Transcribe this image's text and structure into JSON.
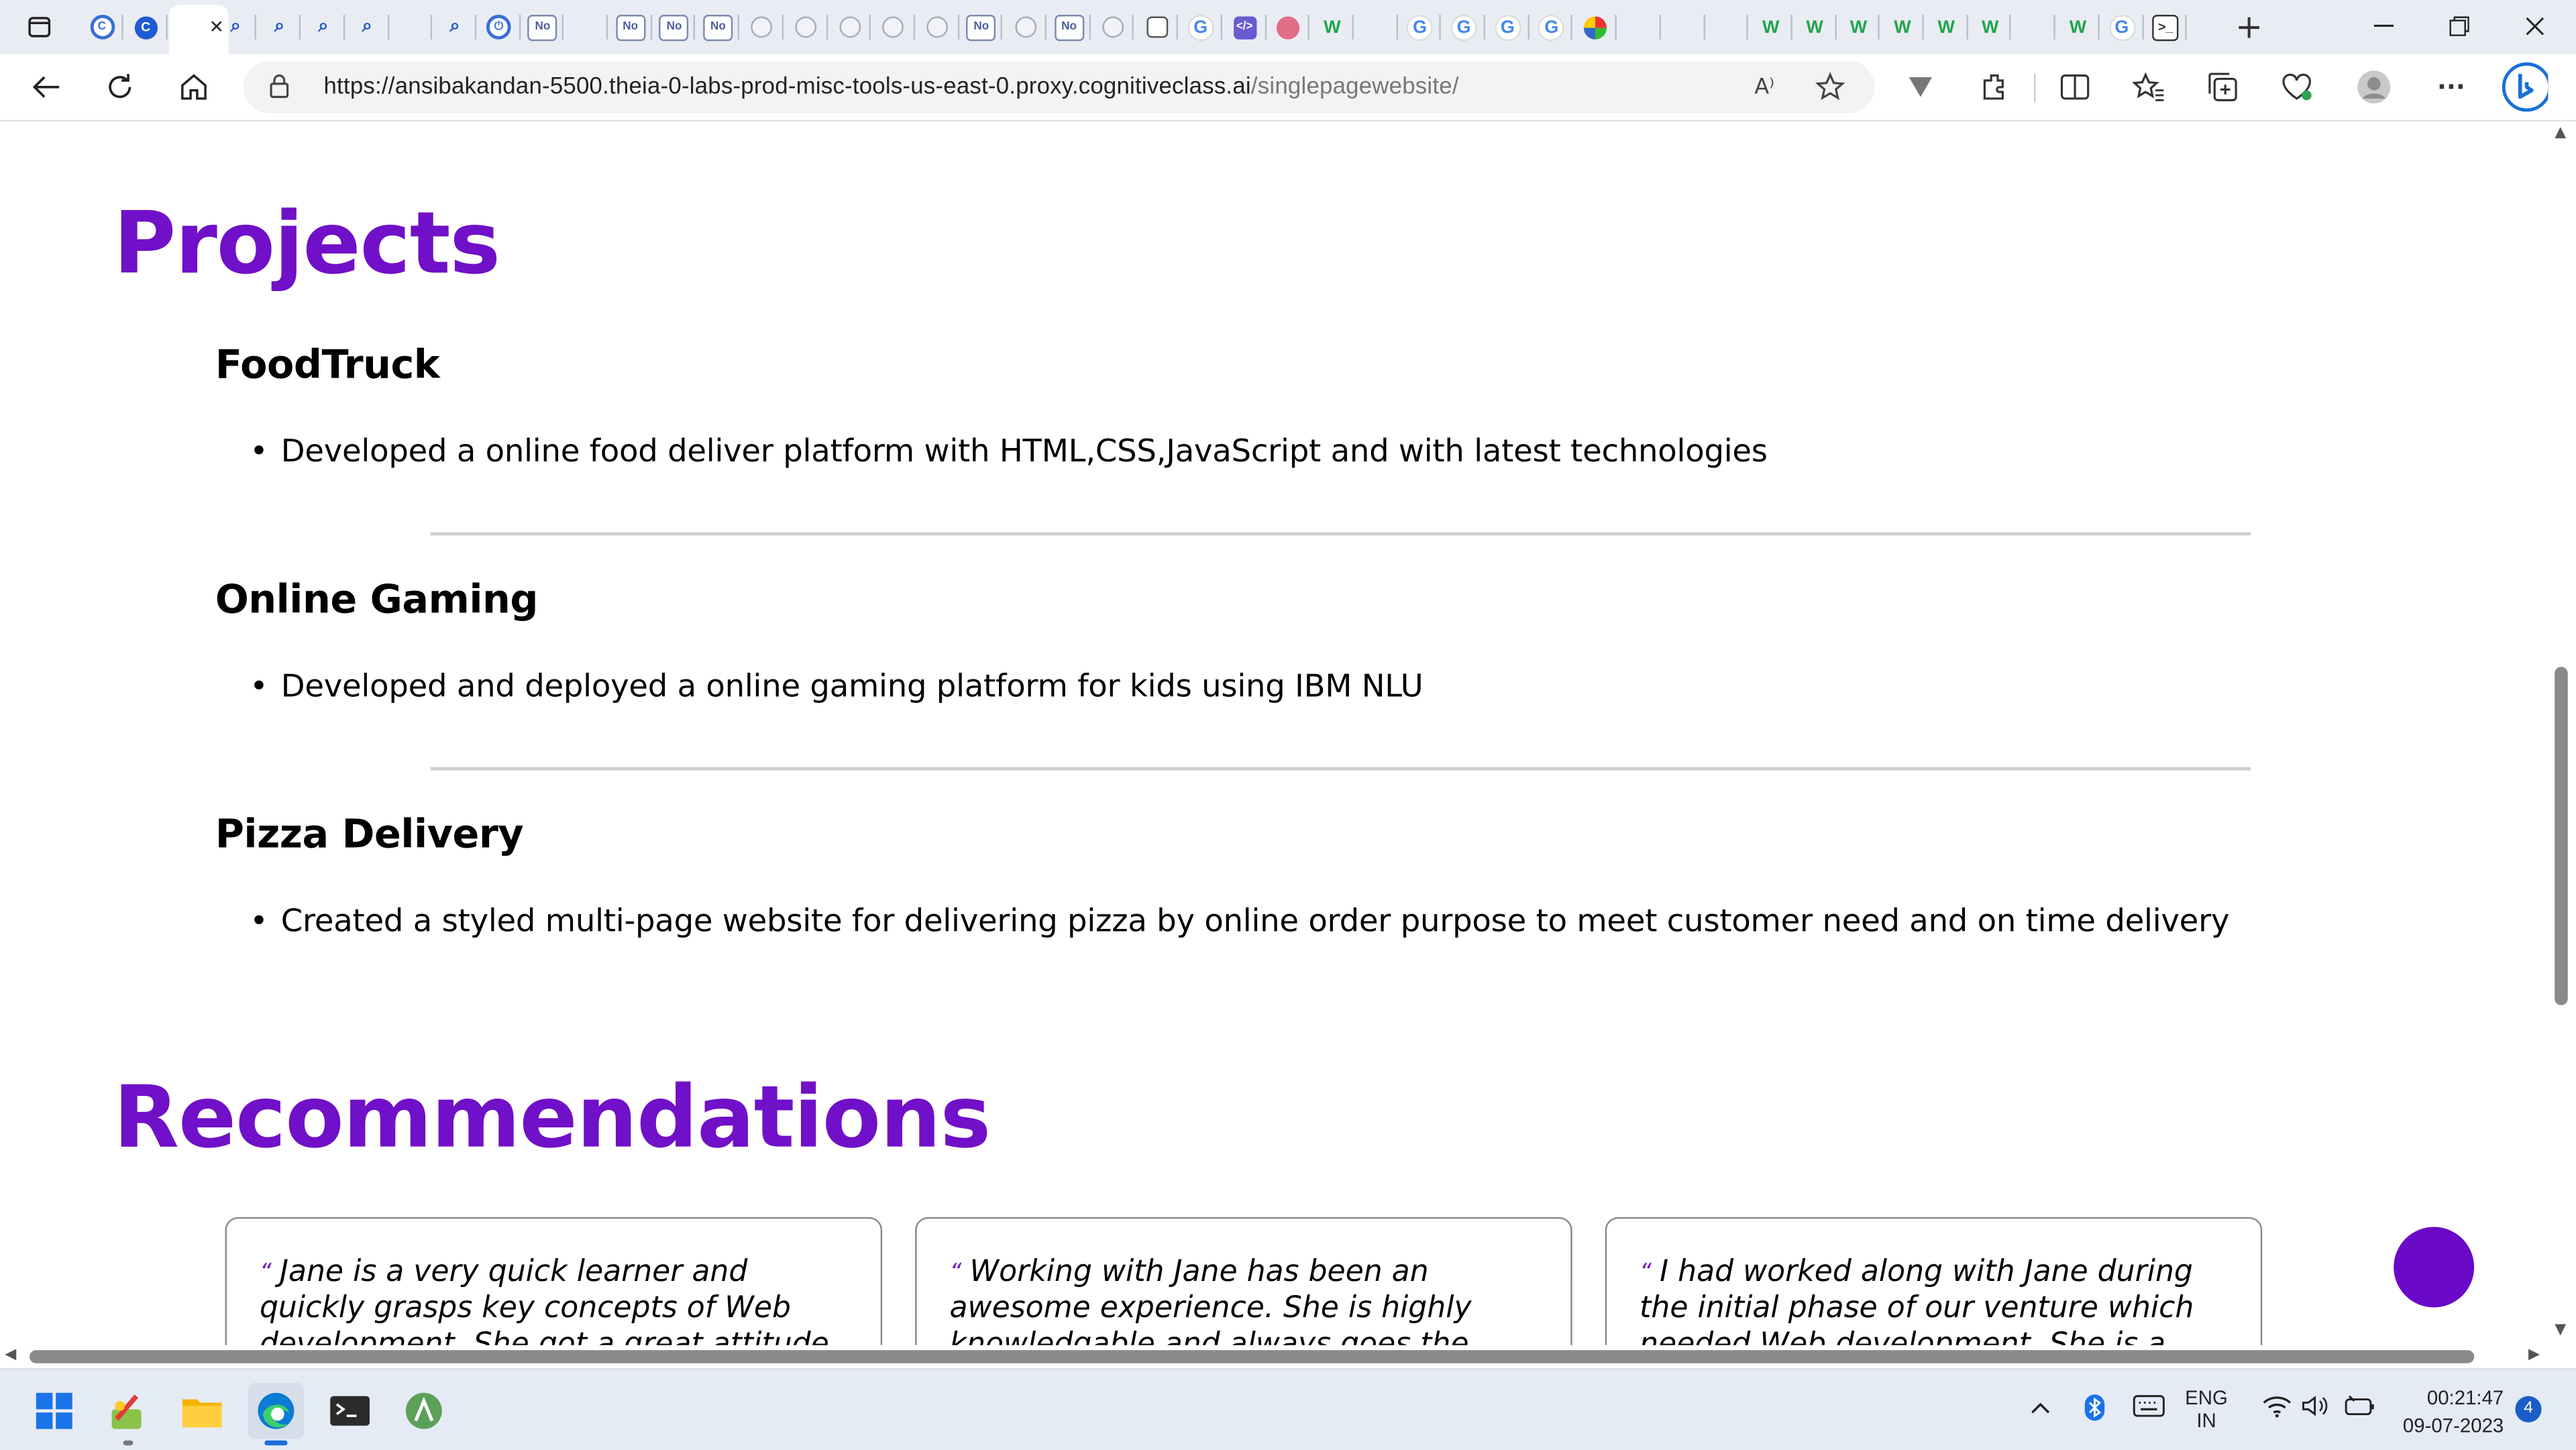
{
  "browser": {
    "tabs": [
      {
        "icon": "c-circle-icon"
      },
      {
        "icon": "c-circle-filled-icon"
      },
      {
        "icon": "page-icon"
      },
      {
        "icon": "search-icon"
      },
      {
        "icon": "search-icon"
      },
      {
        "icon": "search-icon"
      },
      {
        "icon": "search-icon"
      },
      {
        "icon": "page-icon"
      },
      {
        "icon": "search-icon"
      },
      {
        "icon": "power-icon"
      },
      {
        "icon": "no-icon",
        "text": "No"
      },
      {
        "icon": "page-icon"
      },
      {
        "icon": "no-icon",
        "text": "No"
      },
      {
        "icon": "no-icon",
        "text": "No"
      },
      {
        "icon": "no-icon",
        "text": "No"
      },
      {
        "icon": "globe-icon"
      },
      {
        "icon": "globe-icon"
      },
      {
        "icon": "globe-icon"
      },
      {
        "icon": "globe-icon"
      },
      {
        "icon": "globe-icon"
      },
      {
        "icon": "no-icon",
        "text": "No"
      },
      {
        "icon": "globe-icon"
      },
      {
        "icon": "no-icon",
        "text": "No"
      },
      {
        "icon": "globe-icon"
      },
      {
        "icon": "calendar-icon"
      },
      {
        "icon": "google-icon",
        "text": "G"
      },
      {
        "icon": "code-icon",
        "text": "</>"
      },
      {
        "icon": "pink-icon"
      },
      {
        "icon": "w-icon",
        "text": "W"
      },
      {
        "icon": "page-icon"
      },
      {
        "icon": "google-icon",
        "text": "G"
      },
      {
        "icon": "google-icon",
        "text": "G"
      },
      {
        "icon": "google-icon",
        "text": "G"
      },
      {
        "icon": "google-icon",
        "text": "G"
      },
      {
        "icon": "multicolor-icon"
      },
      {
        "icon": "page-icon"
      },
      {
        "icon": "page-icon"
      },
      {
        "icon": "page-icon"
      },
      {
        "icon": "w-icon",
        "text": "W"
      },
      {
        "icon": "w-icon",
        "text": "W"
      },
      {
        "icon": "w-icon",
        "text": "W"
      },
      {
        "icon": "w-icon",
        "text": "W"
      },
      {
        "icon": "w-icon",
        "text": "W"
      },
      {
        "icon": "w-icon",
        "text": "W"
      },
      {
        "icon": "page-icon"
      },
      {
        "icon": "w-icon",
        "text": "W"
      },
      {
        "icon": "google-icon",
        "text": "G"
      },
      {
        "icon": "terminal-icon",
        "text": ">_"
      }
    ],
    "active_tab_close": "✕",
    "new_tab": "+",
    "url_host": "https://ansibakandan-5500.theia-0-labs-prod-misc-tools-us-east-0.proxy.cognitiveclass.ai",
    "url_path": "/singlepagewebsite/",
    "read_aloud": "A⁾",
    "more": "···",
    "accent": "#7010c8"
  },
  "page": {
    "projects_heading": "Projects",
    "projects": [
      {
        "title": "FoodTruck",
        "desc": "Developed a online food deliver platform with HTML,CSS,JavaScript and with latest technologies"
      },
      {
        "title": "Online Gaming",
        "desc": "Developed and deployed a online gaming platform for kids using IBM NLU"
      },
      {
        "title": "Pizza Delivery",
        "desc": "Created a styled multi-page website for delivering pizza by online order purpose to meet customer need and on time delivery"
      }
    ],
    "recommendations_heading": "Recommendations",
    "recommendations": [
      {
        "quote_mark": "“",
        "text": "Jane is a very quick learner and quickly grasps key concepts of Web development. She got a great attitude & she is an"
      },
      {
        "quote_mark": "“",
        "text": "Working with Jane has been an awesome experience. She is highly knowledgable and always goes the extra step to make"
      },
      {
        "quote_mark": "“",
        "text": "I had worked along with Jane during the initial phase of our venture which needed Web development. She is a committed"
      }
    ]
  },
  "taskbar": {
    "apps": [
      "windows-start-icon",
      "paint-icon",
      "file-explorer-icon",
      "edge-icon",
      "terminal-icon",
      "android-studio-icon"
    ],
    "lang_top": "ENG",
    "lang_bottom": "IN",
    "time": "00:21:47",
    "date": "09-07-2023",
    "notification_count": "4"
  }
}
